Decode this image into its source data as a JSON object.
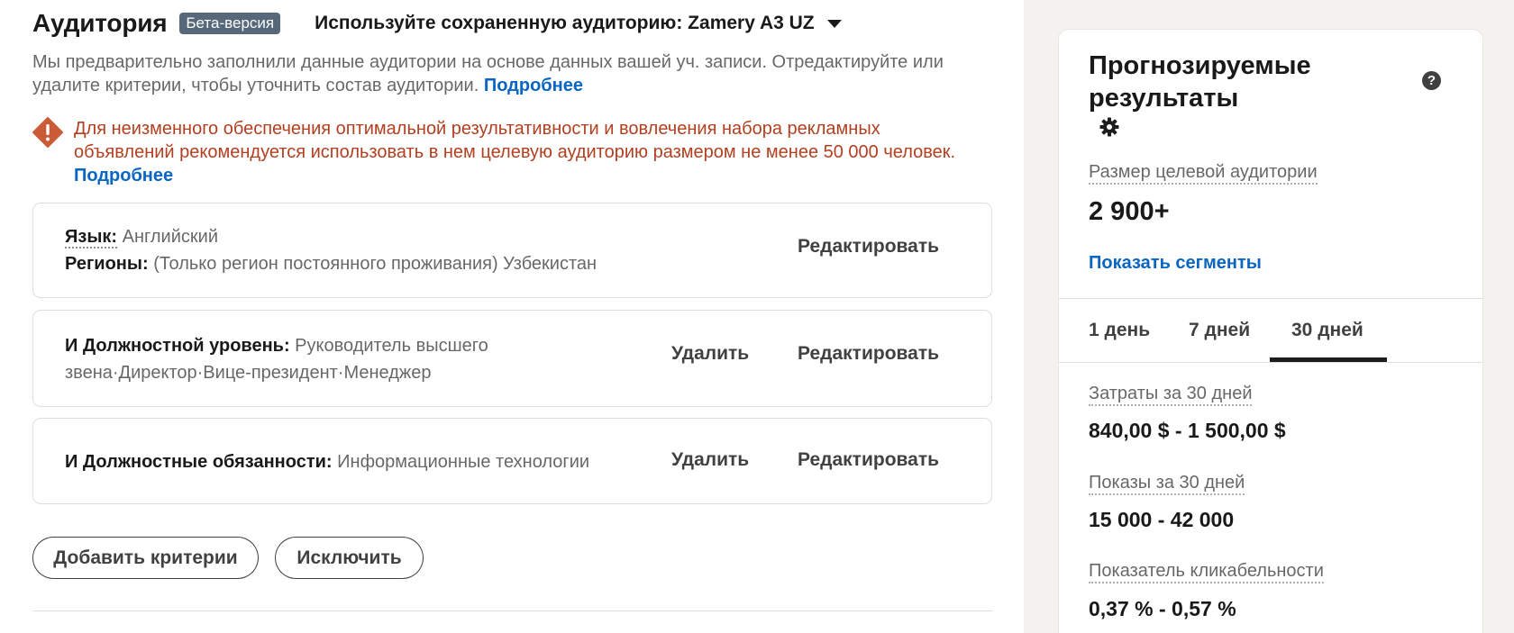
{
  "header": {
    "title": "Аудитория",
    "beta_badge": "Бета-версия",
    "saved_audience": "Используйте сохраненную аудиторию: Zamery A3 UZ"
  },
  "description": {
    "text": "Мы предварительно заполнили данные аудитории на основе данных вашей уч. записи. Отредактируйте или удалите критерии, чтобы уточнить состав аудитории.",
    "link": "Подробнее"
  },
  "warning": {
    "text": "Для неизменного обеспечения оптимальной результативности и вовлечения набора рекламных объявлений рекомендуется использовать в нем целевую аудиторию размером не менее 50 000 человек.",
    "link": "Подробнее",
    "color": "#b24020"
  },
  "criteria": {
    "card1": {
      "lang_label": "Язык:",
      "lang_value": "Английский",
      "region_label": "Регионы:",
      "region_value": "(Только регион постоянного проживания) Узбекистан",
      "edit": "Редактировать"
    },
    "card2": {
      "label": "И Должностной уровень:",
      "value_line1": "Руководитель высшего",
      "value_line2": "звена·Директор·Вице-президент·Менеджер",
      "delete": "Удалить",
      "edit": "Редактировать"
    },
    "card3": {
      "label": "И Должностные обязанности:",
      "value": "Информационные технологии",
      "delete": "Удалить",
      "edit": "Редактировать"
    }
  },
  "buttons": {
    "add_criteria": "Добавить критерии",
    "exclude": "Исключить"
  },
  "forecast": {
    "title_line1": "Прогнозируемые",
    "title_line2": "результаты",
    "audience_size_label": "Размер целевой аудитории",
    "audience_size_value": "2 900+",
    "show_segments": "Показать сегменты",
    "tabs": [
      "1 день",
      "7 дней",
      "30 дней"
    ],
    "active_tab": "30 дней",
    "spend_label": "Затраты за 30 дней",
    "spend_value": "840,00 $ - 1 500,00 $",
    "impressions_label": "Показы за 30 дней",
    "impressions_value": "15 000 - 42 000",
    "ctr_label": "Показатель кликабельности",
    "ctr_value": "0,37 % - 0,57 %"
  },
  "colors": {
    "link": "#0a66c2",
    "side_background": "#f3f2ef",
    "badge": "#56687a"
  }
}
